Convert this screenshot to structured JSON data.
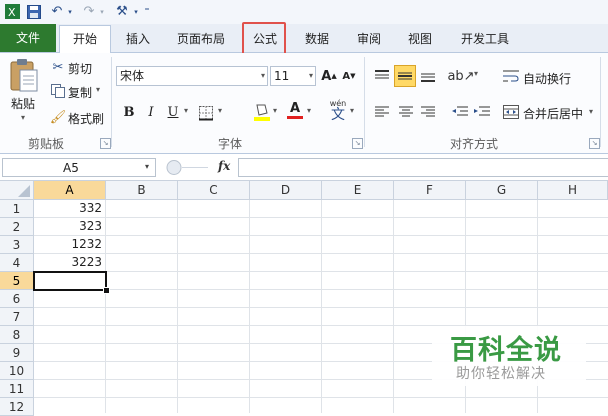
{
  "ribbon": {
    "tabs": [
      {
        "label": "文件"
      },
      {
        "label": "开始"
      },
      {
        "label": "插入"
      },
      {
        "label": "页面布局"
      },
      {
        "label": "公式"
      },
      {
        "label": "数据"
      },
      {
        "label": "审阅"
      },
      {
        "label": "视图"
      },
      {
        "label": "开发工具"
      }
    ],
    "clipboard": {
      "paste_label": "粘贴",
      "cut_label": "剪切",
      "copy_label": "复制",
      "format_painter_label": "格式刷",
      "group_label": "剪贴板"
    },
    "font": {
      "font_name": "宋体",
      "font_size": "11",
      "bold_label": "B",
      "italic_label": "I",
      "underline_label": "U",
      "grow_label": "A",
      "shrink_label": "A",
      "wen_label": "wén",
      "wen_char": "文",
      "font_color_label": "A",
      "group_label": "字体"
    },
    "alignment": {
      "wrap_text_label": "自动换行",
      "merge_center_label": "合并后居中",
      "group_label": "对齐方式"
    }
  },
  "formula_bar": {
    "name_box": "A5",
    "fx_label": "fx",
    "content": ""
  },
  "grid": {
    "columns": [
      "A",
      "B",
      "C",
      "D",
      "E",
      "F",
      "G",
      "H"
    ],
    "rows": [
      "1",
      "2",
      "3",
      "4",
      "5",
      "6",
      "7",
      "8",
      "9",
      "10",
      "11",
      "12"
    ],
    "values": [
      "332",
      "323",
      "1232",
      "3223"
    ],
    "active_cell": "A5"
  },
  "watermark": {
    "title": "百科全说",
    "subtitle": "助你轻松解决"
  },
  "colors": {
    "file_tab": "#2d7a2f",
    "highlight": "#e0514b",
    "selected_header": "#f9d99a"
  }
}
